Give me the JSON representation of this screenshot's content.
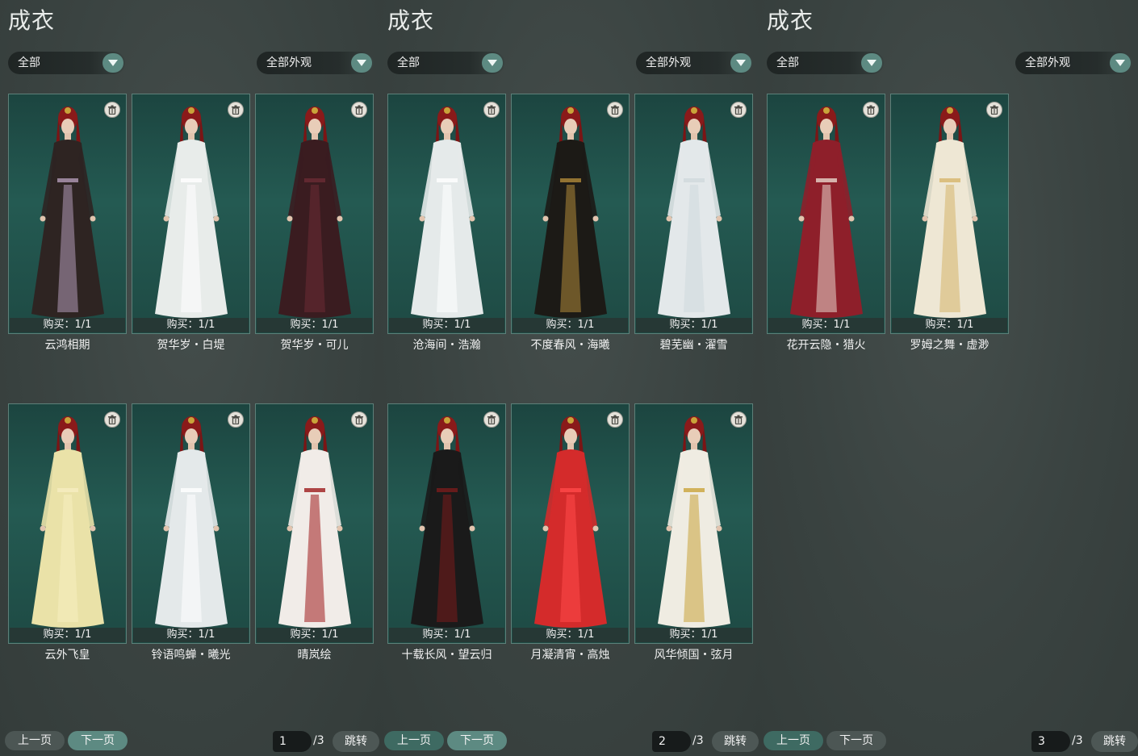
{
  "panels": [
    {
      "title": "成衣",
      "filter_all": "全部",
      "filter_look": "全部外观",
      "items": [
        {
          "buy": "购买：1/1",
          "name": "云鸿相期",
          "dress": "#2e2422",
          "accent": "#b39bb8"
        },
        {
          "buy": "购买：1/1",
          "name": "贺华岁・白堤",
          "dress": "#e8ecea",
          "accent": "#ffffff"
        },
        {
          "buy": "购买：1/1",
          "name": "贺华岁・可儿",
          "dress": "#3a1c20",
          "accent": "#6b2c34"
        },
        {
          "buy": "购买：1/1",
          "name": "云外飞皇",
          "dress": "#eae2a8",
          "accent": "#f6eec0"
        },
        {
          "buy": "购买：1/1",
          "name": "铃语鸣蝉・曦光",
          "dress": "#e4e9ea",
          "accent": "#ffffff"
        },
        {
          "buy": "购买：1/1",
          "name": "晴岚绘",
          "dress": "#f1ece8",
          "accent": "#9e1b1b"
        }
      ],
      "prev_label": "上一页",
      "next_label": "下一页",
      "page": "1",
      "total": "/3",
      "jump_label": "跳转"
    },
    {
      "title": "成衣",
      "filter_all": "全部",
      "filter_look": "全部外观",
      "items": [
        {
          "buy": "购买：1/1",
          "name": "沧海间・浩瀚",
          "dress": "#e5eaea",
          "accent": "#ffffff"
        },
        {
          "buy": "购买：1/1",
          "name": "不度春风・海曦",
          "dress": "#1c1a16",
          "accent": "#b08a3a"
        },
        {
          "buy": "购买：1/1",
          "name": "碧芜幽・濯雪",
          "dress": "#e3e8ea",
          "accent": "#cfd8dc"
        },
        {
          "buy": "购买：1/1",
          "name": "十载长风・望云归",
          "dress": "#1a1a1a",
          "accent": "#7a1c1c"
        },
        {
          "buy": "购买：1/1",
          "name": "月凝清宵・高烛",
          "dress": "#d42b2b",
          "accent": "#ff4a4a"
        },
        {
          "buy": "购买：1/1",
          "name": "风华倾国・弦月",
          "dress": "#efece2",
          "accent": "#c9a43a"
        }
      ],
      "prev_label": "上一页",
      "next_label": "下一页",
      "page": "2",
      "total": "/3",
      "jump_label": "跳转"
    },
    {
      "title": "成衣",
      "filter_all": "全部",
      "filter_look": "全部外观",
      "items": [
        {
          "buy": "购买：1/1",
          "name": "花开云隐・猎火",
          "dress": "#8e1f2a",
          "accent": "#e8d6cc"
        },
        {
          "buy": "购买：1/1",
          "name": "罗姆之舞・虚渺",
          "dress": "#eee7d4",
          "accent": "#d6b56a"
        }
      ],
      "prev_label": "上一页",
      "next_label": "下一页",
      "page": "3",
      "total": "/3",
      "jump_label": "跳转"
    }
  ]
}
